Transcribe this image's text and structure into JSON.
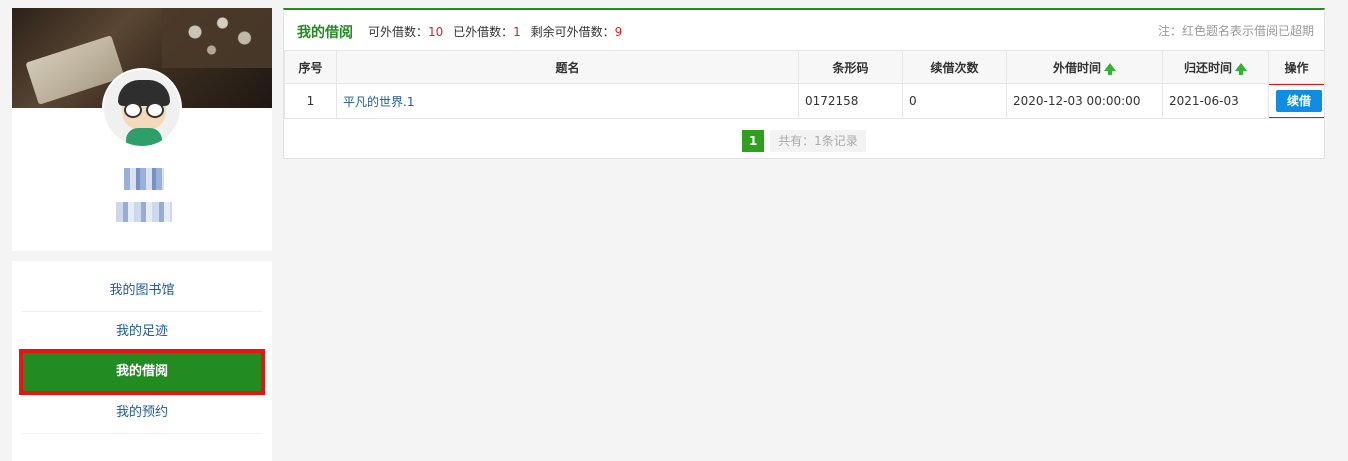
{
  "nav": {
    "items": [
      {
        "label": "我的图书馆",
        "active": false
      },
      {
        "label": "我的足迹",
        "active": false
      },
      {
        "label": "我的借阅",
        "active": true
      },
      {
        "label": "我的预约",
        "active": false
      }
    ]
  },
  "main": {
    "title": "我的借阅",
    "stats": {
      "lendable_label": "可外借数：",
      "lendable_value": "10",
      "borrowed_label": "已外借数：",
      "borrowed_value": "1",
      "remaining_label": "剩余可外借数：",
      "remaining_value": "9"
    },
    "note": "注：红色题名表示借阅已超期",
    "table": {
      "headers": [
        "序号",
        "题名",
        "条形码",
        "续借次数",
        "外借时间",
        "归还时间",
        "操作"
      ],
      "rows": [
        {
          "index": "1",
          "title": "平凡的世界.1",
          "barcode": "0172158",
          "renew_count": "0",
          "borrow_time": "2020-12-03 00:00:00",
          "return_time": "2021-06-03",
          "action": "续借"
        }
      ]
    },
    "pager": {
      "current_page": "1",
      "total_text": "共有：1条记录"
    }
  },
  "colors": {
    "accent_green": "#228b22",
    "highlight_red": "#ee1111",
    "renew_blue": "#0e8de3"
  }
}
